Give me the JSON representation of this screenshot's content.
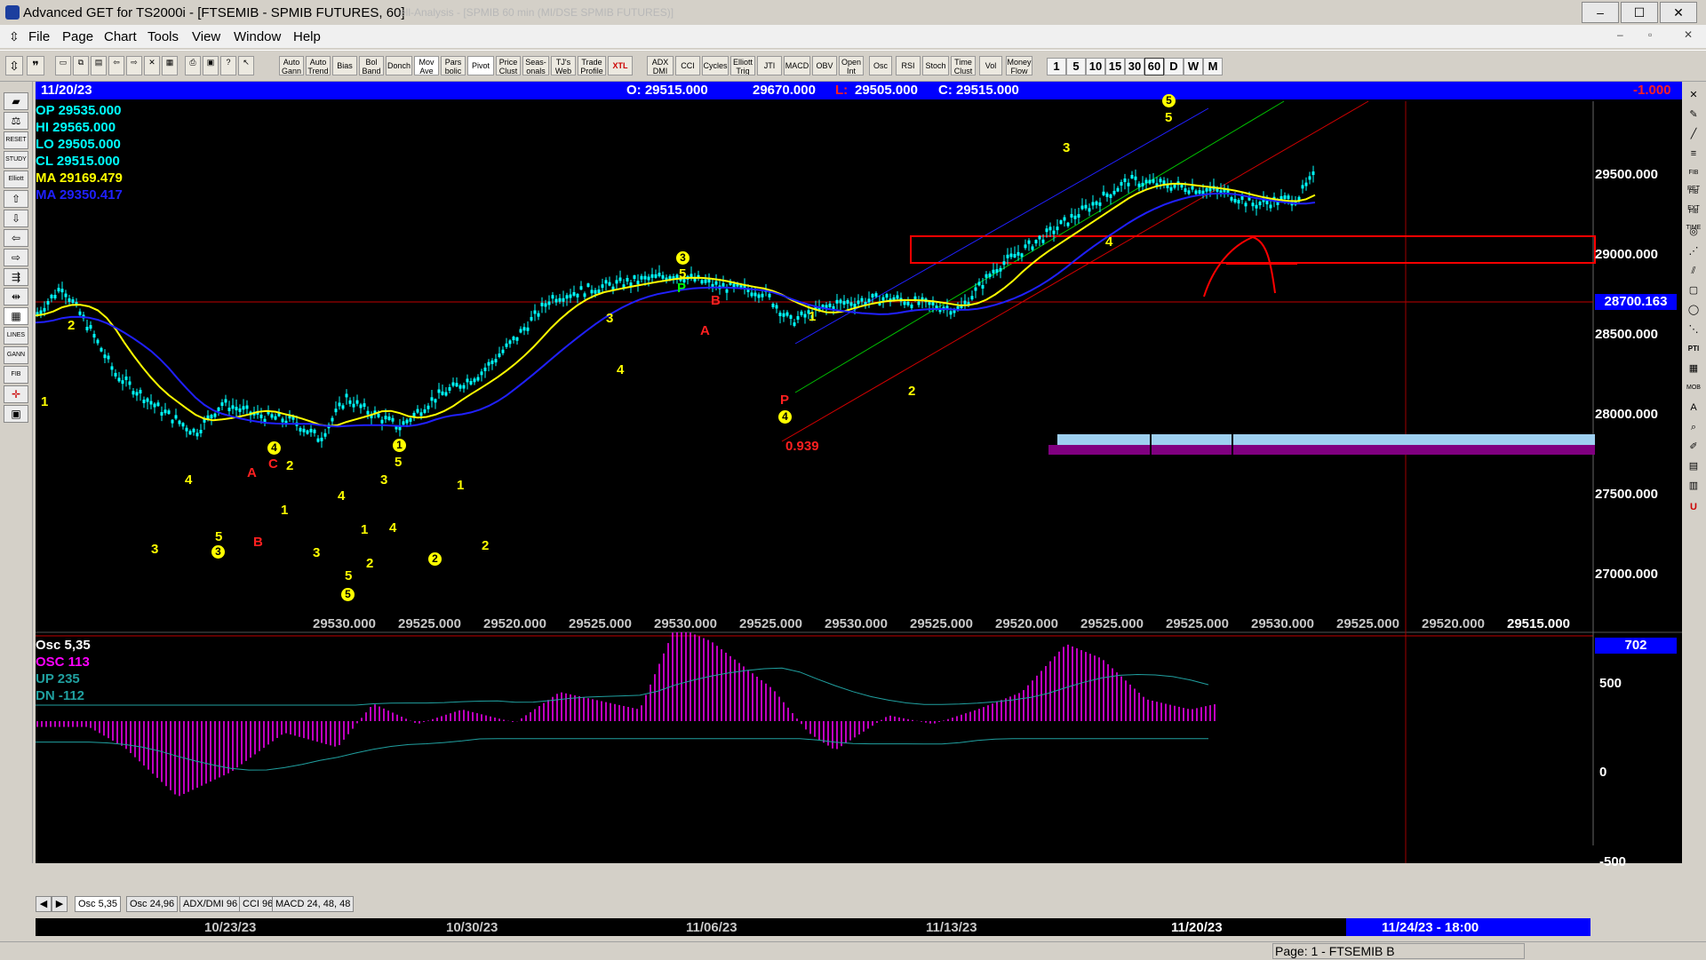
{
  "window": {
    "title": "Advanced GET for TS2000i - [FTSEMIB - SPMIB FUTURES, 60]",
    "ghost_title": "ell-Analysis - [SPMIB 60 min (MI/DSE SPMIB FUTURES)]",
    "min_label": "–",
    "max_label": "☐",
    "close_label": "✕"
  },
  "menu": [
    "File",
    "Page",
    "Chart",
    "Tools",
    "View",
    "Window",
    "Help"
  ],
  "toolbar": {
    "buttons": [
      "Auto Gann",
      "Auto Trend",
      "Bias",
      "Bol Band",
      "Donch",
      "Mov Ave",
      "Pars bolic",
      "Pivot",
      "Price Clust",
      "Seas- onals",
      "TJ's Web",
      "Trade Profile",
      "XTL",
      "ADX DMI",
      "CCI",
      "Cycles",
      "Elliott Trig",
      "JTI",
      "MACD",
      "OBV",
      "Open Int",
      "Osc",
      "RSI",
      "Stoch",
      "Time Clust",
      "Vol",
      "Money Flow"
    ],
    "periods": [
      "1",
      "5",
      "10",
      "15",
      "30",
      "60",
      "D",
      "W",
      "M"
    ],
    "active_period": "60"
  },
  "infobar": {
    "date": "11/20/23",
    "open": "O: 29515.000",
    "high": "29670.000",
    "low_prefix": "L:",
    "low": "29505.000",
    "close": "C: 29515.000",
    "change": "-1.000",
    "colors": {
      "bar": "#0000ff",
      "change": "#ff2020",
      "low_prefix": "#ff2020"
    }
  },
  "legend": [
    {
      "label": "OP  29535.000",
      "color": "#00ffff"
    },
    {
      "label": "HI   29565.000",
      "color": "#00ffff"
    },
    {
      "label": "LO  29505.000",
      "color": "#00ffff"
    },
    {
      "label": "CL  29515.000",
      "color": "#00ffff"
    },
    {
      "label": "MA  29169.479",
      "color": "#ffff00"
    },
    {
      "label": "MA  29350.417",
      "color": "#2020ff"
    }
  ],
  "price_axis": [
    "29500.000",
    "29000.000",
    "28500.000",
    "28000.000",
    "27500.000",
    "27000.000"
  ],
  "price_tag": "28700.163",
  "x_bottom_labels": [
    "29530.000",
    "29525.000",
    "29520.000",
    "29525.000",
    "29530.000",
    "29525.000",
    "29530.000",
    "29525.000",
    "29520.000",
    "29525.000",
    "29525.000",
    "29530.000",
    "29525.000",
    "29520.000",
    "29515.000"
  ],
  "annotations": {
    "ratio": "0.939",
    "wave_labels": [
      "1",
      "2",
      "3",
      "4",
      "5",
      "A",
      "B",
      "C",
      "P"
    ]
  },
  "osc_panel": {
    "title": "Osc 5,35",
    "osc": "OSC 113",
    "up": "UP   235",
    "dn": "DN  -112",
    "value_tag": "702",
    "axis": [
      "500",
      "0",
      "-500"
    ],
    "colors": {
      "osc": "#ff00ff",
      "up": "#20a0a0",
      "dn": "#20a0a0"
    }
  },
  "tabs": [
    "Osc 5,35",
    "Osc 24,96",
    "ADX/DMI 96",
    "CCI 96",
    "MACD 24, 48, 48"
  ],
  "dates": [
    "10/23/23",
    "10/30/23",
    "11/06/23",
    "11/13/23",
    "11/20/23"
  ],
  "date_tag": "11/24/23 - 18:00",
  "status": "Page: 1 - FTSEMIB B"
}
